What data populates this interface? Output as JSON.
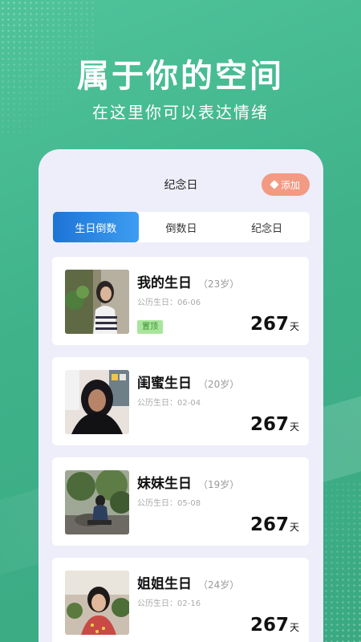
{
  "hero": {
    "title": "属于你的空间",
    "subtitle": "在这里你可以表达情绪"
  },
  "header": {
    "title": "纪念日",
    "add_label": "添加",
    "add_icon": "diamond-plus-icon"
  },
  "tabs": [
    {
      "label": "生日倒数",
      "active": true
    },
    {
      "label": "倒数日",
      "active": false
    },
    {
      "label": "纪念日",
      "active": false
    }
  ],
  "cards": [
    {
      "name": "我的生日",
      "age": "（23岁）",
      "lunar": "公历生日：06-06",
      "badge": "置顶",
      "days": "267",
      "unit": "天"
    },
    {
      "name": "闺蜜生日",
      "age": "（20岁）",
      "lunar": "公历生日：02-04",
      "badge": "",
      "days": "267",
      "unit": "天"
    },
    {
      "name": "妹妹生日",
      "age": "（19岁）",
      "lunar": "公历生日：05-08",
      "badge": "",
      "days": "267",
      "unit": "天"
    },
    {
      "name": "姐姐生日",
      "age": "（24岁）",
      "lunar": "公历生日：02-16",
      "badge": "",
      "days": "267",
      "unit": "天"
    }
  ],
  "colors": {
    "background": "#45b98f",
    "accent_tab": "#2a86e4",
    "add_button": "#f39a83",
    "pin_badge": "#a9e59c"
  }
}
